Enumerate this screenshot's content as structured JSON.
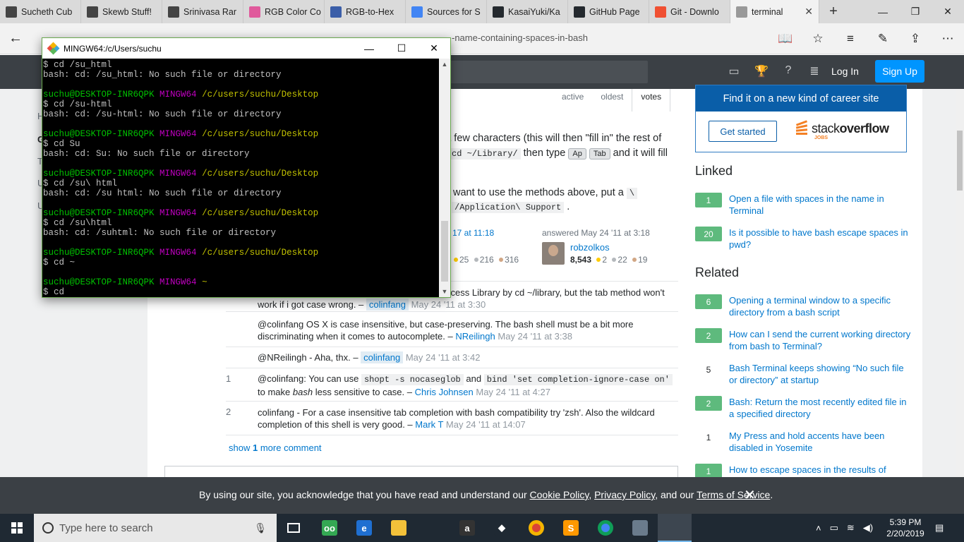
{
  "browser": {
    "tabs": [
      {
        "title": "Sucheth Cub",
        "icon": "page-icon",
        "color": "#444444"
      },
      {
        "title": "Skewb Stuff!",
        "icon": "page-icon",
        "color": "#444444"
      },
      {
        "title": "Srinivasa Rar",
        "icon": "page-icon",
        "color": "#444444"
      },
      {
        "title": "RGB Color Co",
        "icon": "rgb-color-icon",
        "color": "#e05a9c"
      },
      {
        "title": "RGB-to-Hex",
        "icon": "rgb-to-hex-icon",
        "color": "#3b5ea8"
      },
      {
        "title": "Sources for S",
        "icon": "google-docs-icon",
        "color": "#4285f4"
      },
      {
        "title": "KasaiYuki/Ka",
        "icon": "github-icon",
        "color": "#24292e"
      },
      {
        "title": "GitHub Page",
        "icon": "github-icon",
        "color": "#24292e"
      },
      {
        "title": "Git - Downlo",
        "icon": "git-icon",
        "color": "#f05032"
      },
      {
        "title": "terminal",
        "icon": "stackoverflow-icon",
        "color": "#999999"
      }
    ],
    "url_tail": "-name-containing-spaces-in-bash"
  },
  "so": {
    "login": "Log In",
    "signup": "Sign Up",
    "sort_tabs": [
      "active",
      "oldest",
      "votes"
    ],
    "left_cut": [
      "H",
      "G",
      "T",
      "U",
      "U"
    ],
    "answer_lines": {
      "l1_tail": "st few characters (this will then \"fill in\" the rest of",
      "l2_code": "cd ~/Library/",
      "l2_mid": "then type",
      "l2_kbd1": "Ap",
      "l2_kbd2": "Tab",
      "l2_tail": "and it will fill",
      "l3_head": "want to use the methods above, put a",
      "l3_code": "\\",
      "l4_code": "/Application\\ Support",
      "l4_tail": "."
    },
    "edited_tail": "17 at 11:18",
    "answered": "answered May 24 '11 at 3:18",
    "user": {
      "name": "robzolkos",
      "rep": "8,543",
      "gold": "2",
      "silver": "22",
      "bronze": "19"
    },
    "editor_badges": {
      "gold": "25",
      "silver": "216",
      "bronze": "316"
    },
    "comments": [
      {
        "score": "",
        "pre": "ccess Library by cd ~/library, but the tab method won't",
        "text": "work if i got case wrong. –",
        "user": "colinfang",
        "user_hl": true,
        "date": "May 24 '11 at 3:30"
      },
      {
        "score": "",
        "text": "@colinfang OS X is case insensitive, but case-preserving. The bash shell must be a bit more discriminating when it comes to autocomplete. –",
        "user": "NReilingh",
        "user_hl": false,
        "date": "May 24 '11 at 3:38"
      },
      {
        "score": "",
        "text": "@NReilingh - Aha, thx. –",
        "user": "colinfang",
        "user_hl": true,
        "date": "May 24 '11 at 3:42"
      },
      {
        "score": "1",
        "t1": "@colinfang: You can use",
        "code1": "shopt -s nocaseglob",
        "t2": "and",
        "code2": "bind 'set completion-ignore-case on'",
        "t3": "to make",
        "em": "bash",
        "t4": "less sensitive to case. –",
        "user": "Chris Johnsen",
        "user_hl": false,
        "date": "May 24 '11 at 4:27"
      },
      {
        "score": "2",
        "text": "colinfang - For a case insensitive tab completion with bash compatibility try 'zsh'. Also the wildcard completion of this shell is very good. –",
        "user": "Mark T",
        "user_hl": false,
        "date": "May 24 '11 at 14:07"
      }
    ],
    "show_more": {
      "pre": "show",
      "count": "1",
      "post": "more comment"
    }
  },
  "sidebar": {
    "career_head": "Find it on a new kind of career site",
    "get_started": "Get started",
    "brand_a": "stack",
    "brand_b": "overflow",
    "brand_jobs": "JOBS",
    "linked_title": "Linked",
    "linked": [
      {
        "votes": "1",
        "accepted": true,
        "title": "Open a file with spaces in the name in Terminal"
      },
      {
        "votes": "20",
        "accepted": true,
        "title": "Is it possible to have bash escape spaces in pwd?"
      }
    ],
    "related_title": "Related",
    "related": [
      {
        "votes": "6",
        "accepted": true,
        "title": "Opening a terminal window to a specific directory from a bash script"
      },
      {
        "votes": "2",
        "accepted": true,
        "title": "How can I send the current working directory from bash to Terminal?"
      },
      {
        "votes": "5",
        "accepted": false,
        "title": "Bash Terminal keeps showing “No such file or directory” at startup"
      },
      {
        "votes": "2",
        "accepted": true,
        "title": "Bash: Return the most recently edited file in a specified directory"
      },
      {
        "votes": "1",
        "accepted": false,
        "title": "My Press and hold accents have been disabled in Yosemite"
      },
      {
        "votes": "1",
        "accepted": true,
        "title": "How to escape spaces in the results of"
      }
    ]
  },
  "cookie": {
    "pre": "By using our site, you acknowledge that you have read and understand our",
    "l1": "Cookie Policy",
    "sep1": ",",
    "l2": "Privacy Policy",
    "sep2": ", and our",
    "l3": "Terms of Service",
    "post": "."
  },
  "terminal": {
    "title": "MINGW64:/c/Users/suchu",
    "lines": [
      {
        "kind": "out",
        "text": "$ cd /su_html"
      },
      {
        "kind": "out",
        "text": "bash: cd: /su_html: No such file or directory"
      },
      {
        "kind": "blank",
        "text": ""
      },
      {
        "kind": "prompt",
        "user": "suchu@DESKTOP-INR6QPK",
        "sys": "MINGW64",
        "path": "/c/users/suchu/Desktop"
      },
      {
        "kind": "out",
        "text": "$ cd /su-html"
      },
      {
        "kind": "out",
        "text": "bash: cd: /su-html: No such file or directory"
      },
      {
        "kind": "blank",
        "text": ""
      },
      {
        "kind": "prompt",
        "user": "suchu@DESKTOP-INR6QPK",
        "sys": "MINGW64",
        "path": "/c/users/suchu/Desktop"
      },
      {
        "kind": "out",
        "text": "$ cd Su"
      },
      {
        "kind": "out",
        "text": "bash: cd: Su: No such file or directory"
      },
      {
        "kind": "blank",
        "text": ""
      },
      {
        "kind": "prompt",
        "user": "suchu@DESKTOP-INR6QPK",
        "sys": "MINGW64",
        "path": "/c/users/suchu/Desktop"
      },
      {
        "kind": "out",
        "text": "$ cd /su\\ html"
      },
      {
        "kind": "out",
        "text": "bash: cd: /su html: No such file or directory"
      },
      {
        "kind": "blank",
        "text": ""
      },
      {
        "kind": "prompt",
        "user": "suchu@DESKTOP-INR6QPK",
        "sys": "MINGW64",
        "path": "/c/users/suchu/Desktop"
      },
      {
        "kind": "out",
        "text": "$ cd /su\\html"
      },
      {
        "kind": "out",
        "text": "bash: cd: /suhtml: No such file or directory"
      },
      {
        "kind": "blank",
        "text": ""
      },
      {
        "kind": "prompt",
        "user": "suchu@DESKTOP-INR6QPK",
        "sys": "MINGW64",
        "path": "/c/users/suchu/Desktop"
      },
      {
        "kind": "out",
        "text": "$ cd ~"
      },
      {
        "kind": "blank",
        "text": ""
      },
      {
        "kind": "prompt",
        "user": "suchu@DESKTOP-INR6QPK",
        "sys": "MINGW64",
        "path": "~"
      },
      {
        "kind": "out",
        "text": "$ cd"
      }
    ]
  },
  "taskbar": {
    "search_placeholder": "Type here to search",
    "time": "5:39 PM",
    "date": "2/20/2019",
    "apps": [
      {
        "name": "task-view-icon",
        "label": "",
        "color": "#1f2933"
      },
      {
        "name": "tripadvisor-icon",
        "label": "oo",
        "color": "#34a853"
      },
      {
        "name": "edge-icon",
        "label": "e",
        "color": "#1f6fd1"
      },
      {
        "name": "file-explorer-icon",
        "label": "",
        "color": "#f3c13a"
      },
      {
        "name": "amazon-icon",
        "label": "a",
        "color": "#333333"
      },
      {
        "name": "dropbox-icon",
        "label": "◆",
        "color": "#1f2933"
      },
      {
        "name": "chrome-icon",
        "label": "",
        "color": "#db4437"
      },
      {
        "name": "sublime-text-icon",
        "label": "S",
        "color": "#ff9800"
      },
      {
        "name": "chrome-app-icon",
        "label": "",
        "color": "#4285f4"
      },
      {
        "name": "photos-icon",
        "label": "",
        "color": "#6a7b8c"
      },
      {
        "name": "git-bash-icon",
        "label": "",
        "color": "#3d4650"
      }
    ]
  }
}
